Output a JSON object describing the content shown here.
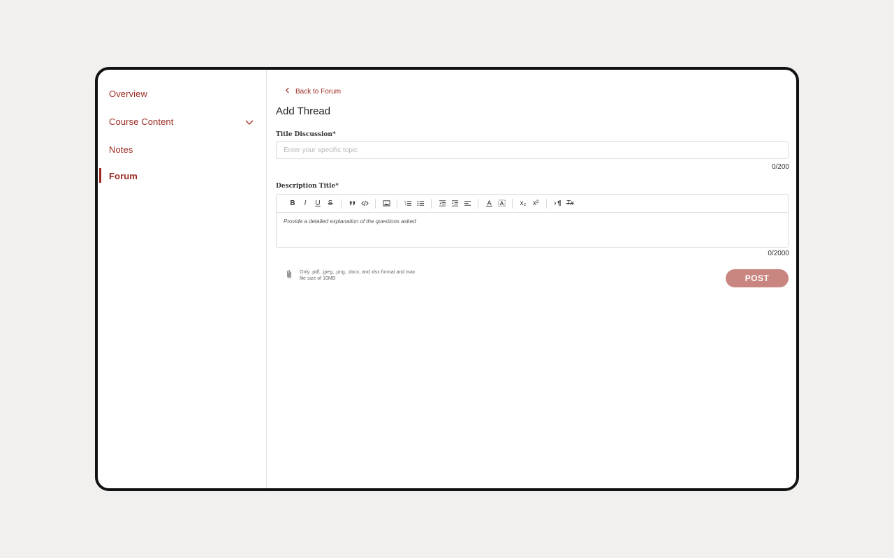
{
  "sidebar": {
    "items": [
      {
        "label": "Overview"
      },
      {
        "label": "Course Content"
      },
      {
        "label": "Notes"
      },
      {
        "label": "Forum",
        "active": true
      }
    ]
  },
  "header": {
    "back_label": "Back to Forum",
    "title": "Add Thread"
  },
  "form": {
    "title_label": "Title Discussion*",
    "title_placeholder": "Enter your specific topic",
    "title_value": "",
    "title_count": "0/200",
    "desc_label": "Description Title*",
    "desc_placeholder": "Provide a detailed explanation of the questions asked",
    "desc_count": "0/2000",
    "attach_hint": "Only .pdf, .jpeg, .png, .docx, and xlsx format and max file size of 10MB",
    "post_label": "POST"
  },
  "toolbar": {
    "bold": "B",
    "italic": "I",
    "underline": "U",
    "strike": "S",
    "subscript": "x₂",
    "superscript": "x²",
    "clear_format": "Tx"
  },
  "colors": {
    "accent": "#9c2b23",
    "post_button": "#c98580",
    "background": "#f1f0ee"
  }
}
